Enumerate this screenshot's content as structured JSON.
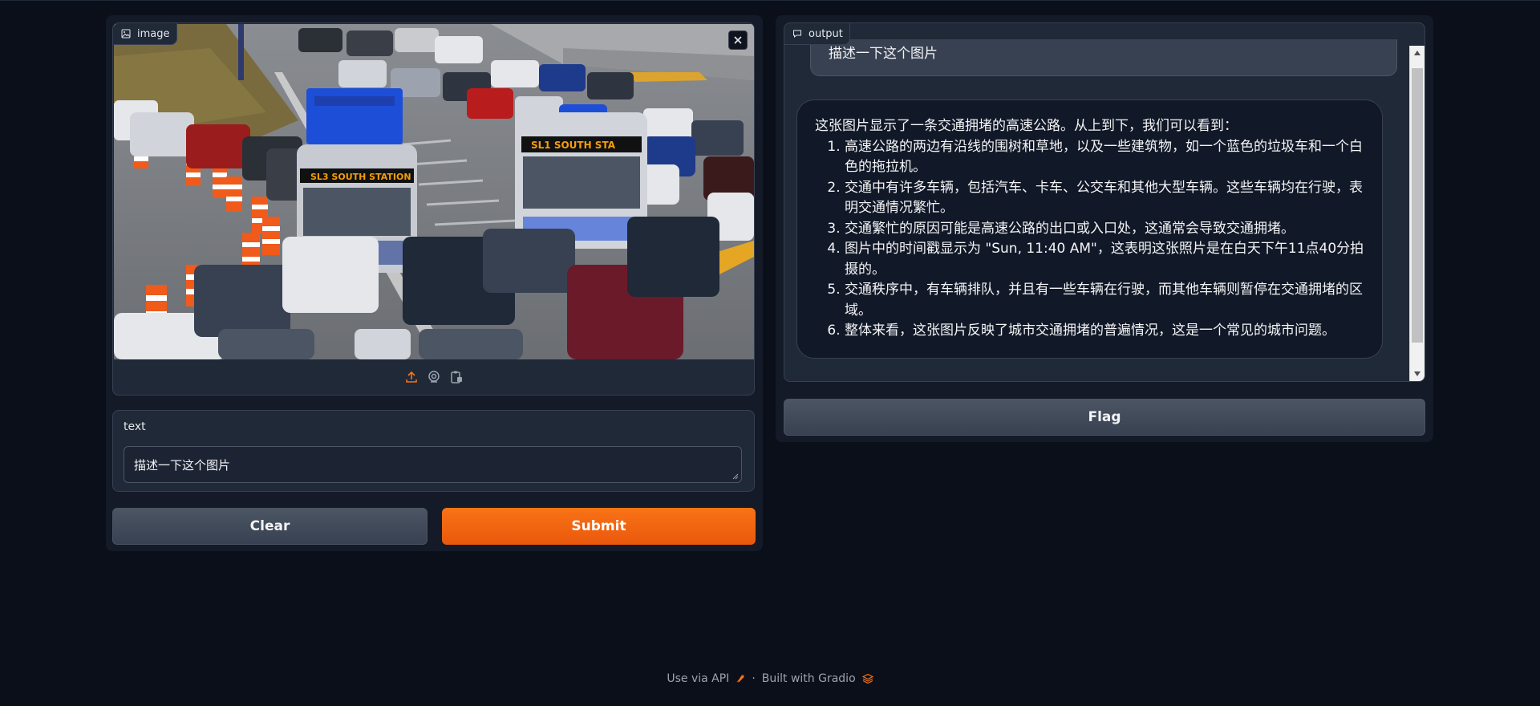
{
  "image_input": {
    "label": "image",
    "icon": "image-icon",
    "close_icon": "close-icon",
    "toolbar": [
      "upload-icon",
      "webcam-icon",
      "clipboard-icon"
    ]
  },
  "text_input": {
    "label": "text",
    "value": "描述一下这个图片"
  },
  "buttons": {
    "clear": "Clear",
    "submit": "Submit",
    "flag": "Flag"
  },
  "output": {
    "label": "output",
    "icon": "chat-icon",
    "user_message": "描述一下这个图片",
    "bot_intro": "这张图片显示了一条交通拥堵的高速公路。从上到下，我们可以看到：",
    "bot_items": [
      "高速公路的两边有沿线的围树和草地，以及一些建筑物，如一个蓝色的垃圾车和一个白色的拖拉机。",
      "交通中有许多车辆，包括汽车、卡车、公交车和其他大型车辆。这些车辆均在行驶，表明交通情况繁忙。",
      "交通繁忙的原因可能是高速公路的出口或入口处，这通常会导致交通拥堵。",
      "图片中的时间戳显示为 \"Sun, 11:40 AM\"，这表明这张照片是在白天下午11点40分拍摄的。",
      "交通秩序中，有车辆排队，并且有一些车辆在行驶，而其他车辆则暂停在交通拥堵的区域。",
      "整体来看，这张图片反映了城市交通拥堵的普遍情况，这是一个常见的城市问题。"
    ]
  },
  "photo": {
    "bus_sign_1": "SL3 SOUTH STATION",
    "bus_sign_2": "SL1 SOUTH STA"
  },
  "footer": {
    "api": "Use via API",
    "separator": "·",
    "built": "Built with Gradio"
  },
  "colors": {
    "background": "#0b0f19",
    "panel": "#141a27",
    "block": "#1f2937",
    "accent": "#f97316"
  }
}
